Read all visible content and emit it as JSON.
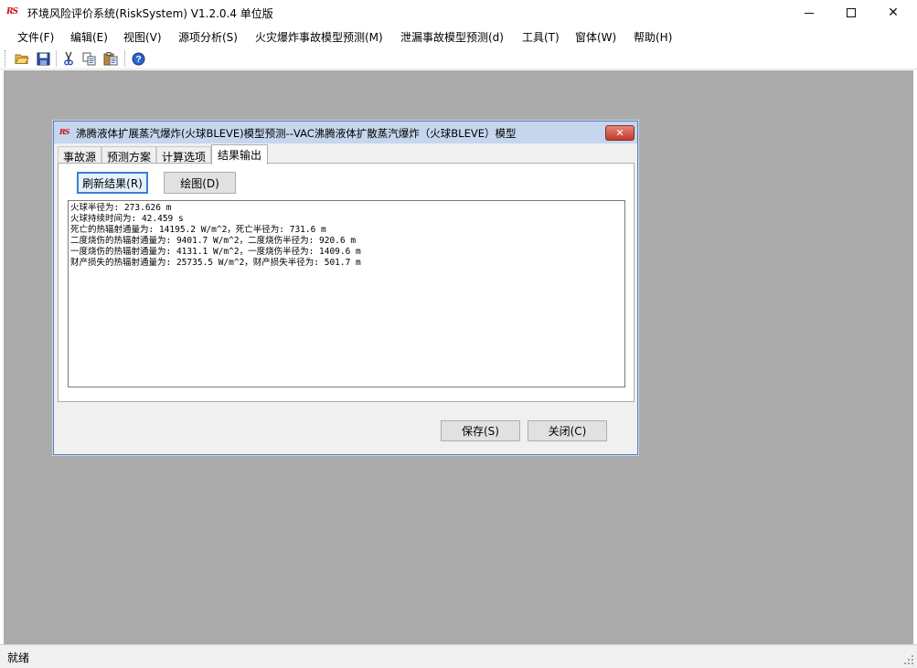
{
  "window": {
    "logo_text": "RS",
    "title": "环境风险评价系统(RiskSystem) V1.2.0.4 单位版",
    "minimize_glyph": "",
    "maximize_glyph": "",
    "close_glyph": "✕"
  },
  "menu": [
    {
      "label": "文件(F)"
    },
    {
      "label": "编辑(E)"
    },
    {
      "label": "视图(V)"
    },
    {
      "label": "源项分析(S)"
    },
    {
      "label": "火灾爆炸事故模型预测(M)"
    },
    {
      "label": "泄漏事故模型预测(d)"
    },
    {
      "label": "工具(T)"
    },
    {
      "label": "窗体(W)"
    },
    {
      "label": "帮助(H)"
    }
  ],
  "toolbar": {
    "icons": [
      "open-folder-icon",
      "save-disk-icon",
      "cut-scissors-icon",
      "copy-icon",
      "paste-icon",
      "help-icon"
    ]
  },
  "dialog": {
    "logo_text": "RS",
    "title": "沸腾液体扩展蒸汽爆炸(火球BLEVE)模型预测--VAC沸腾液体扩散蒸汽爆炸（火球BLEVE）模型",
    "close_glyph": "✕",
    "tabs": [
      {
        "label": "事故源"
      },
      {
        "label": "预测方案"
      },
      {
        "label": "计算选项"
      },
      {
        "label": "结果输出"
      }
    ],
    "active_tab": "结果输出",
    "refresh_button": "刷新结果(R)",
    "plot_button": "绘图(D)",
    "output_lines": [
      "火球半径为: 273.626 m",
      "火球持续时间为: 42.459 s",
      "死亡的热辐射通量为: 14195.2 W/m^2，死亡半径为: 731.6 m",
      "二度烧伤的热辐射通量为: 9401.7 W/m^2，二度烧伤半径为: 920.6 m",
      "一度烧伤的热辐射通量为: 4131.1 W/m^2，一度烧伤半径为: 1409.6 m",
      "财产损失的热辐射通量为: 25735.5 W/m^2，财产损失半径为: 501.7 m"
    ],
    "save_button": "保存(S)",
    "close_button": "关闭(C)"
  },
  "status": {
    "text": "就绪"
  }
}
